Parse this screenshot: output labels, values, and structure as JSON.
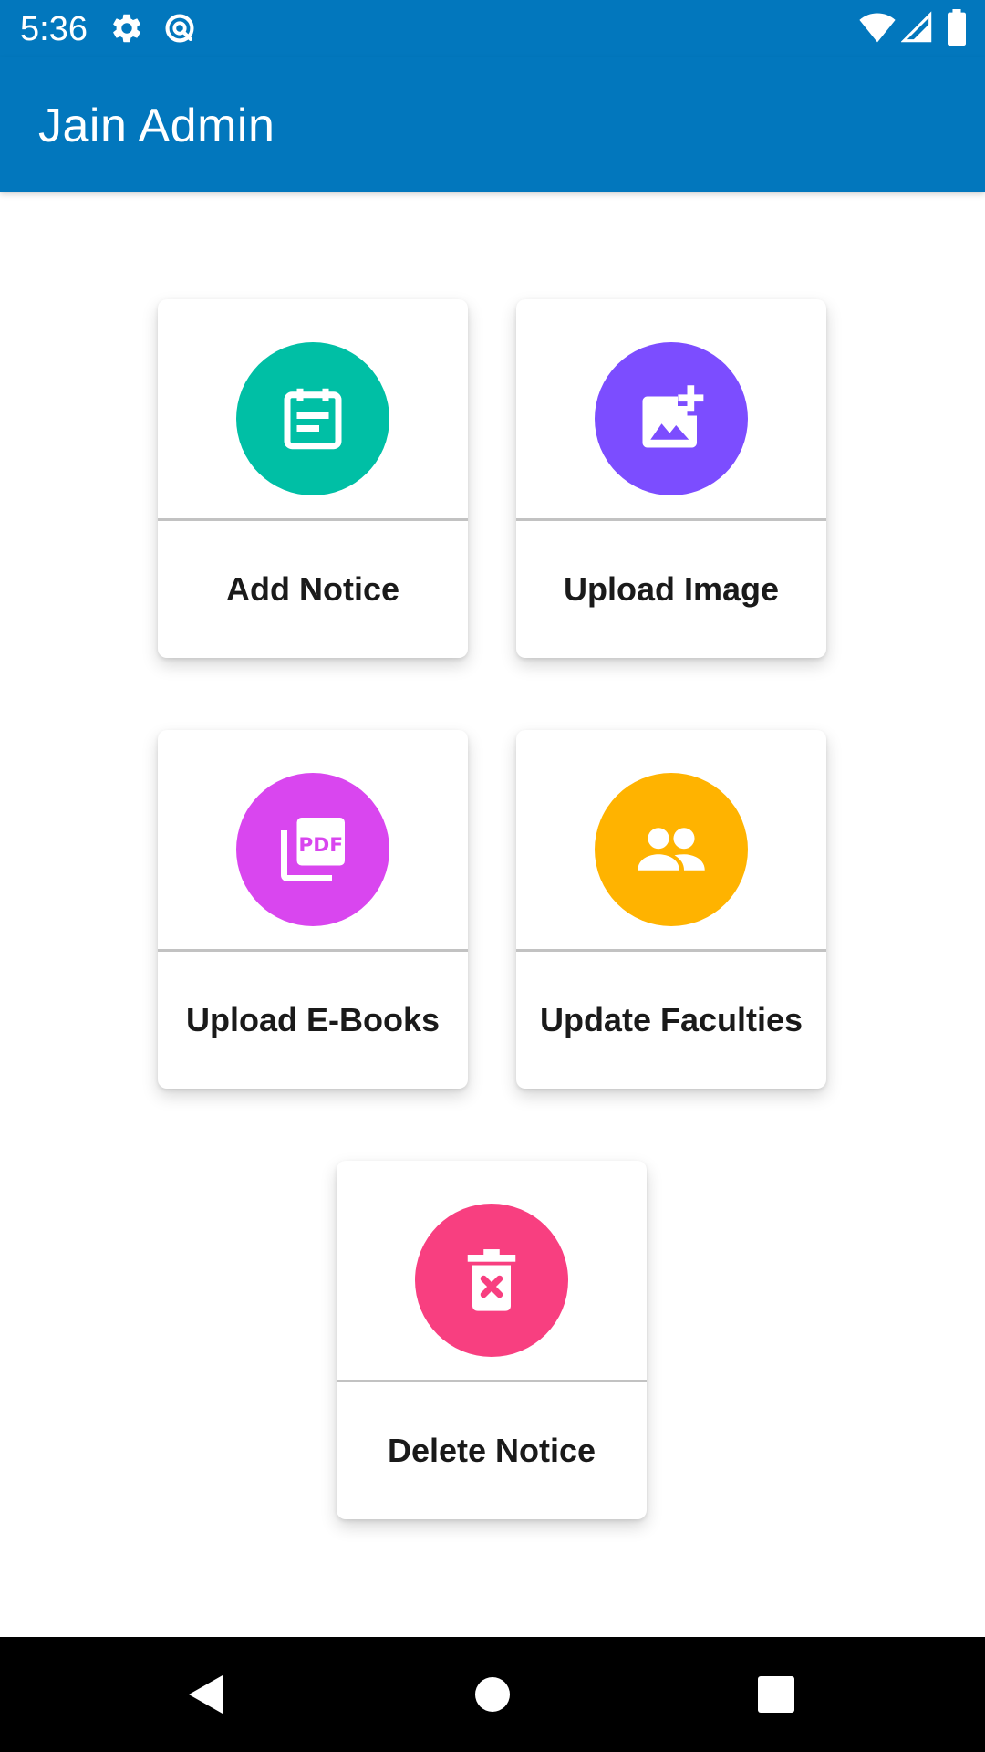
{
  "status_bar": {
    "time": "5:36",
    "icons": [
      "gear-icon",
      "data-saver-icon",
      "wifi-icon",
      "signal-icon",
      "battery-icon"
    ]
  },
  "app_bar": {
    "title": "Jain Admin",
    "color": "#0277bd"
  },
  "menu": {
    "add_notice": {
      "label": "Add Notice",
      "icon": "calendar-notice-icon",
      "color": "#00bfa5"
    },
    "upload_image": {
      "label": "Upload Image",
      "icon": "add-photo-icon",
      "color": "#7c4dff"
    },
    "upload_ebooks": {
      "label": "Upload E-Books",
      "icon": "pdf-icon",
      "color": "#d946ef"
    },
    "update_faculties": {
      "label": "Update Faculties",
      "icon": "people-icon",
      "color": "#ffb300"
    },
    "delete_notice": {
      "label": "Delete Notice",
      "icon": "delete-icon",
      "color": "#f83f80"
    }
  },
  "nav_bar": {
    "icons": [
      "back-icon",
      "home-icon",
      "recents-icon"
    ]
  }
}
